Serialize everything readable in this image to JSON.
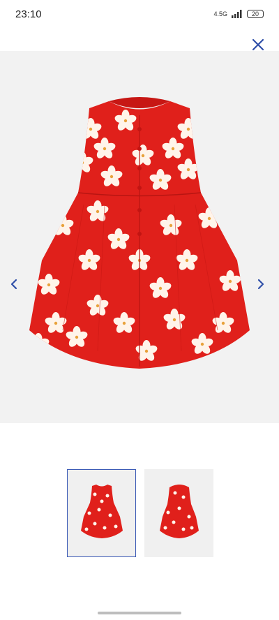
{
  "status_bar": {
    "time": "23:10",
    "network": "4.5G",
    "battery": "20"
  },
  "colors": {
    "accent": "#2f4fa8",
    "dress_red": "#e0201b",
    "flower_white": "#fff4ea"
  },
  "icons": {
    "close": "close-icon",
    "prev": "chevron-left-icon",
    "next": "chevron-right-icon"
  },
  "gallery": {
    "image_count": 2,
    "selected_index": 0
  }
}
